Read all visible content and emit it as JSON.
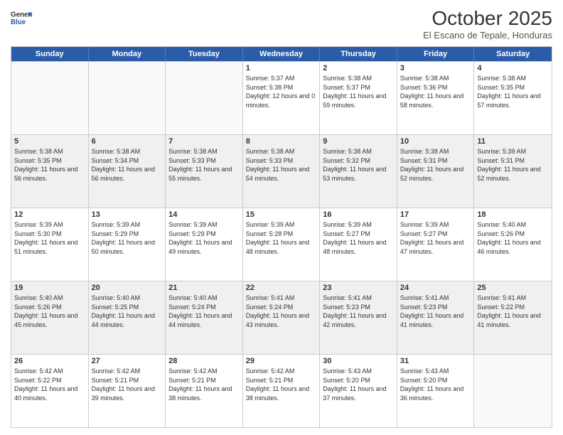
{
  "header": {
    "logo_line1": "General",
    "logo_line2": "Blue",
    "month_title": "October 2025",
    "subtitle": "El Escano de Tepale, Honduras"
  },
  "weekdays": [
    "Sunday",
    "Monday",
    "Tuesday",
    "Wednesday",
    "Thursday",
    "Friday",
    "Saturday"
  ],
  "rows": [
    [
      {
        "day": "",
        "info": ""
      },
      {
        "day": "",
        "info": ""
      },
      {
        "day": "",
        "info": ""
      },
      {
        "day": "1",
        "info": "Sunrise: 5:37 AM\nSunset: 5:38 PM\nDaylight: 12 hours\nand 0 minutes."
      },
      {
        "day": "2",
        "info": "Sunrise: 5:38 AM\nSunset: 5:37 PM\nDaylight: 11 hours\nand 59 minutes."
      },
      {
        "day": "3",
        "info": "Sunrise: 5:38 AM\nSunset: 5:36 PM\nDaylight: 11 hours\nand 58 minutes."
      },
      {
        "day": "4",
        "info": "Sunrise: 5:38 AM\nSunset: 5:35 PM\nDaylight: 11 hours\nand 57 minutes."
      }
    ],
    [
      {
        "day": "5",
        "info": "Sunrise: 5:38 AM\nSunset: 5:35 PM\nDaylight: 11 hours\nand 56 minutes."
      },
      {
        "day": "6",
        "info": "Sunrise: 5:38 AM\nSunset: 5:34 PM\nDaylight: 11 hours\nand 56 minutes."
      },
      {
        "day": "7",
        "info": "Sunrise: 5:38 AM\nSunset: 5:33 PM\nDaylight: 11 hours\nand 55 minutes."
      },
      {
        "day": "8",
        "info": "Sunrise: 5:38 AM\nSunset: 5:33 PM\nDaylight: 11 hours\nand 54 minutes."
      },
      {
        "day": "9",
        "info": "Sunrise: 5:38 AM\nSunset: 5:32 PM\nDaylight: 11 hours\nand 53 minutes."
      },
      {
        "day": "10",
        "info": "Sunrise: 5:38 AM\nSunset: 5:31 PM\nDaylight: 11 hours\nand 52 minutes."
      },
      {
        "day": "11",
        "info": "Sunrise: 5:39 AM\nSunset: 5:31 PM\nDaylight: 11 hours\nand 52 minutes."
      }
    ],
    [
      {
        "day": "12",
        "info": "Sunrise: 5:39 AM\nSunset: 5:30 PM\nDaylight: 11 hours\nand 51 minutes."
      },
      {
        "day": "13",
        "info": "Sunrise: 5:39 AM\nSunset: 5:29 PM\nDaylight: 11 hours\nand 50 minutes."
      },
      {
        "day": "14",
        "info": "Sunrise: 5:39 AM\nSunset: 5:29 PM\nDaylight: 11 hours\nand 49 minutes."
      },
      {
        "day": "15",
        "info": "Sunrise: 5:39 AM\nSunset: 5:28 PM\nDaylight: 11 hours\nand 48 minutes."
      },
      {
        "day": "16",
        "info": "Sunrise: 5:39 AM\nSunset: 5:27 PM\nDaylight: 11 hours\nand 48 minutes."
      },
      {
        "day": "17",
        "info": "Sunrise: 5:39 AM\nSunset: 5:27 PM\nDaylight: 11 hours\nand 47 minutes."
      },
      {
        "day": "18",
        "info": "Sunrise: 5:40 AM\nSunset: 5:26 PM\nDaylight: 11 hours\nand 46 minutes."
      }
    ],
    [
      {
        "day": "19",
        "info": "Sunrise: 5:40 AM\nSunset: 5:26 PM\nDaylight: 11 hours\nand 45 minutes."
      },
      {
        "day": "20",
        "info": "Sunrise: 5:40 AM\nSunset: 5:25 PM\nDaylight: 11 hours\nand 44 minutes."
      },
      {
        "day": "21",
        "info": "Sunrise: 5:40 AM\nSunset: 5:24 PM\nDaylight: 11 hours\nand 44 minutes."
      },
      {
        "day": "22",
        "info": "Sunrise: 5:41 AM\nSunset: 5:24 PM\nDaylight: 11 hours\nand 43 minutes."
      },
      {
        "day": "23",
        "info": "Sunrise: 5:41 AM\nSunset: 5:23 PM\nDaylight: 11 hours\nand 42 minutes."
      },
      {
        "day": "24",
        "info": "Sunrise: 5:41 AM\nSunset: 5:23 PM\nDaylight: 11 hours\nand 41 minutes."
      },
      {
        "day": "25",
        "info": "Sunrise: 5:41 AM\nSunset: 5:22 PM\nDaylight: 11 hours\nand 41 minutes."
      }
    ],
    [
      {
        "day": "26",
        "info": "Sunrise: 5:42 AM\nSunset: 5:22 PM\nDaylight: 11 hours\nand 40 minutes."
      },
      {
        "day": "27",
        "info": "Sunrise: 5:42 AM\nSunset: 5:21 PM\nDaylight: 11 hours\nand 39 minutes."
      },
      {
        "day": "28",
        "info": "Sunrise: 5:42 AM\nSunset: 5:21 PM\nDaylight: 11 hours\nand 38 minutes."
      },
      {
        "day": "29",
        "info": "Sunrise: 5:42 AM\nSunset: 5:21 PM\nDaylight: 11 hours\nand 38 minutes."
      },
      {
        "day": "30",
        "info": "Sunrise: 5:43 AM\nSunset: 5:20 PM\nDaylight: 11 hours\nand 37 minutes."
      },
      {
        "day": "31",
        "info": "Sunrise: 5:43 AM\nSunset: 5:20 PM\nDaylight: 11 hours\nand 36 minutes."
      },
      {
        "day": "",
        "info": ""
      }
    ]
  ]
}
